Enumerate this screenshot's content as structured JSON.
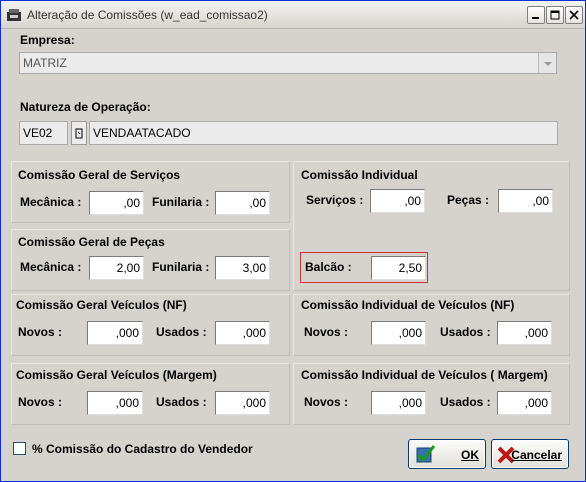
{
  "window": {
    "title": "Alteração de Comissões (w_ead_comissao2)"
  },
  "empresa": {
    "label": "Empresa:",
    "value": "MATRIZ"
  },
  "natureza": {
    "label": "Natureza de Operação:",
    "code": "VE02",
    "description": "VENDAATACADO"
  },
  "servicos": {
    "title": "Comissão Geral de Serviços",
    "mecanica_label": "Mecânica :",
    "mecanica_value": ",00",
    "funilaria_label": "Funilaria :",
    "funilaria_value": ",00"
  },
  "individual": {
    "title": "Comissão Individual",
    "servicos_label": "Serviços :",
    "servicos_value": ",00",
    "pecas_label": "Peças :",
    "pecas_value": ",00",
    "balcao_label": "Balcão :",
    "balcao_value": "2,50"
  },
  "pecas": {
    "title": "Comissão Geral de Peças",
    "mecanica_label": "Mecânica :",
    "mecanica_value": "2,00",
    "funilaria_label": "Funilaria :",
    "funilaria_value": "3,00"
  },
  "veiculos_nf": {
    "title": "Comissão Geral Veículos (NF)",
    "novos_label": "Novos :",
    "novos_value": ",000",
    "usados_label": "Usados :",
    "usados_value": ",000"
  },
  "ind_veiculos_nf": {
    "title": "Comissão Individual de Veículos (NF)",
    "novos_label": "Novos :",
    "novos_value": ",000",
    "usados_label": "Usados :",
    "usados_value": ",000"
  },
  "veiculos_margem": {
    "title": "Comissão Geral Veículos (Margem)",
    "novos_label": "Novos :",
    "novos_value": ",000",
    "usados_label": "Usados :",
    "usados_value": ",000"
  },
  "ind_veiculos_margem": {
    "title": "Comissão Individual de Veículos ( Margem)",
    "novos_label": "Novos :",
    "novos_value": ",000",
    "usados_label": "Usados :",
    "usados_value": ",000"
  },
  "checkbox": {
    "label": "% Comissão do Cadastro do Vendedor",
    "checked": false
  },
  "buttons": {
    "ok": "OK",
    "cancel": "Cancelar"
  },
  "colors": {
    "highlight_border": "#d03030",
    "title_border": "#0831d9"
  }
}
